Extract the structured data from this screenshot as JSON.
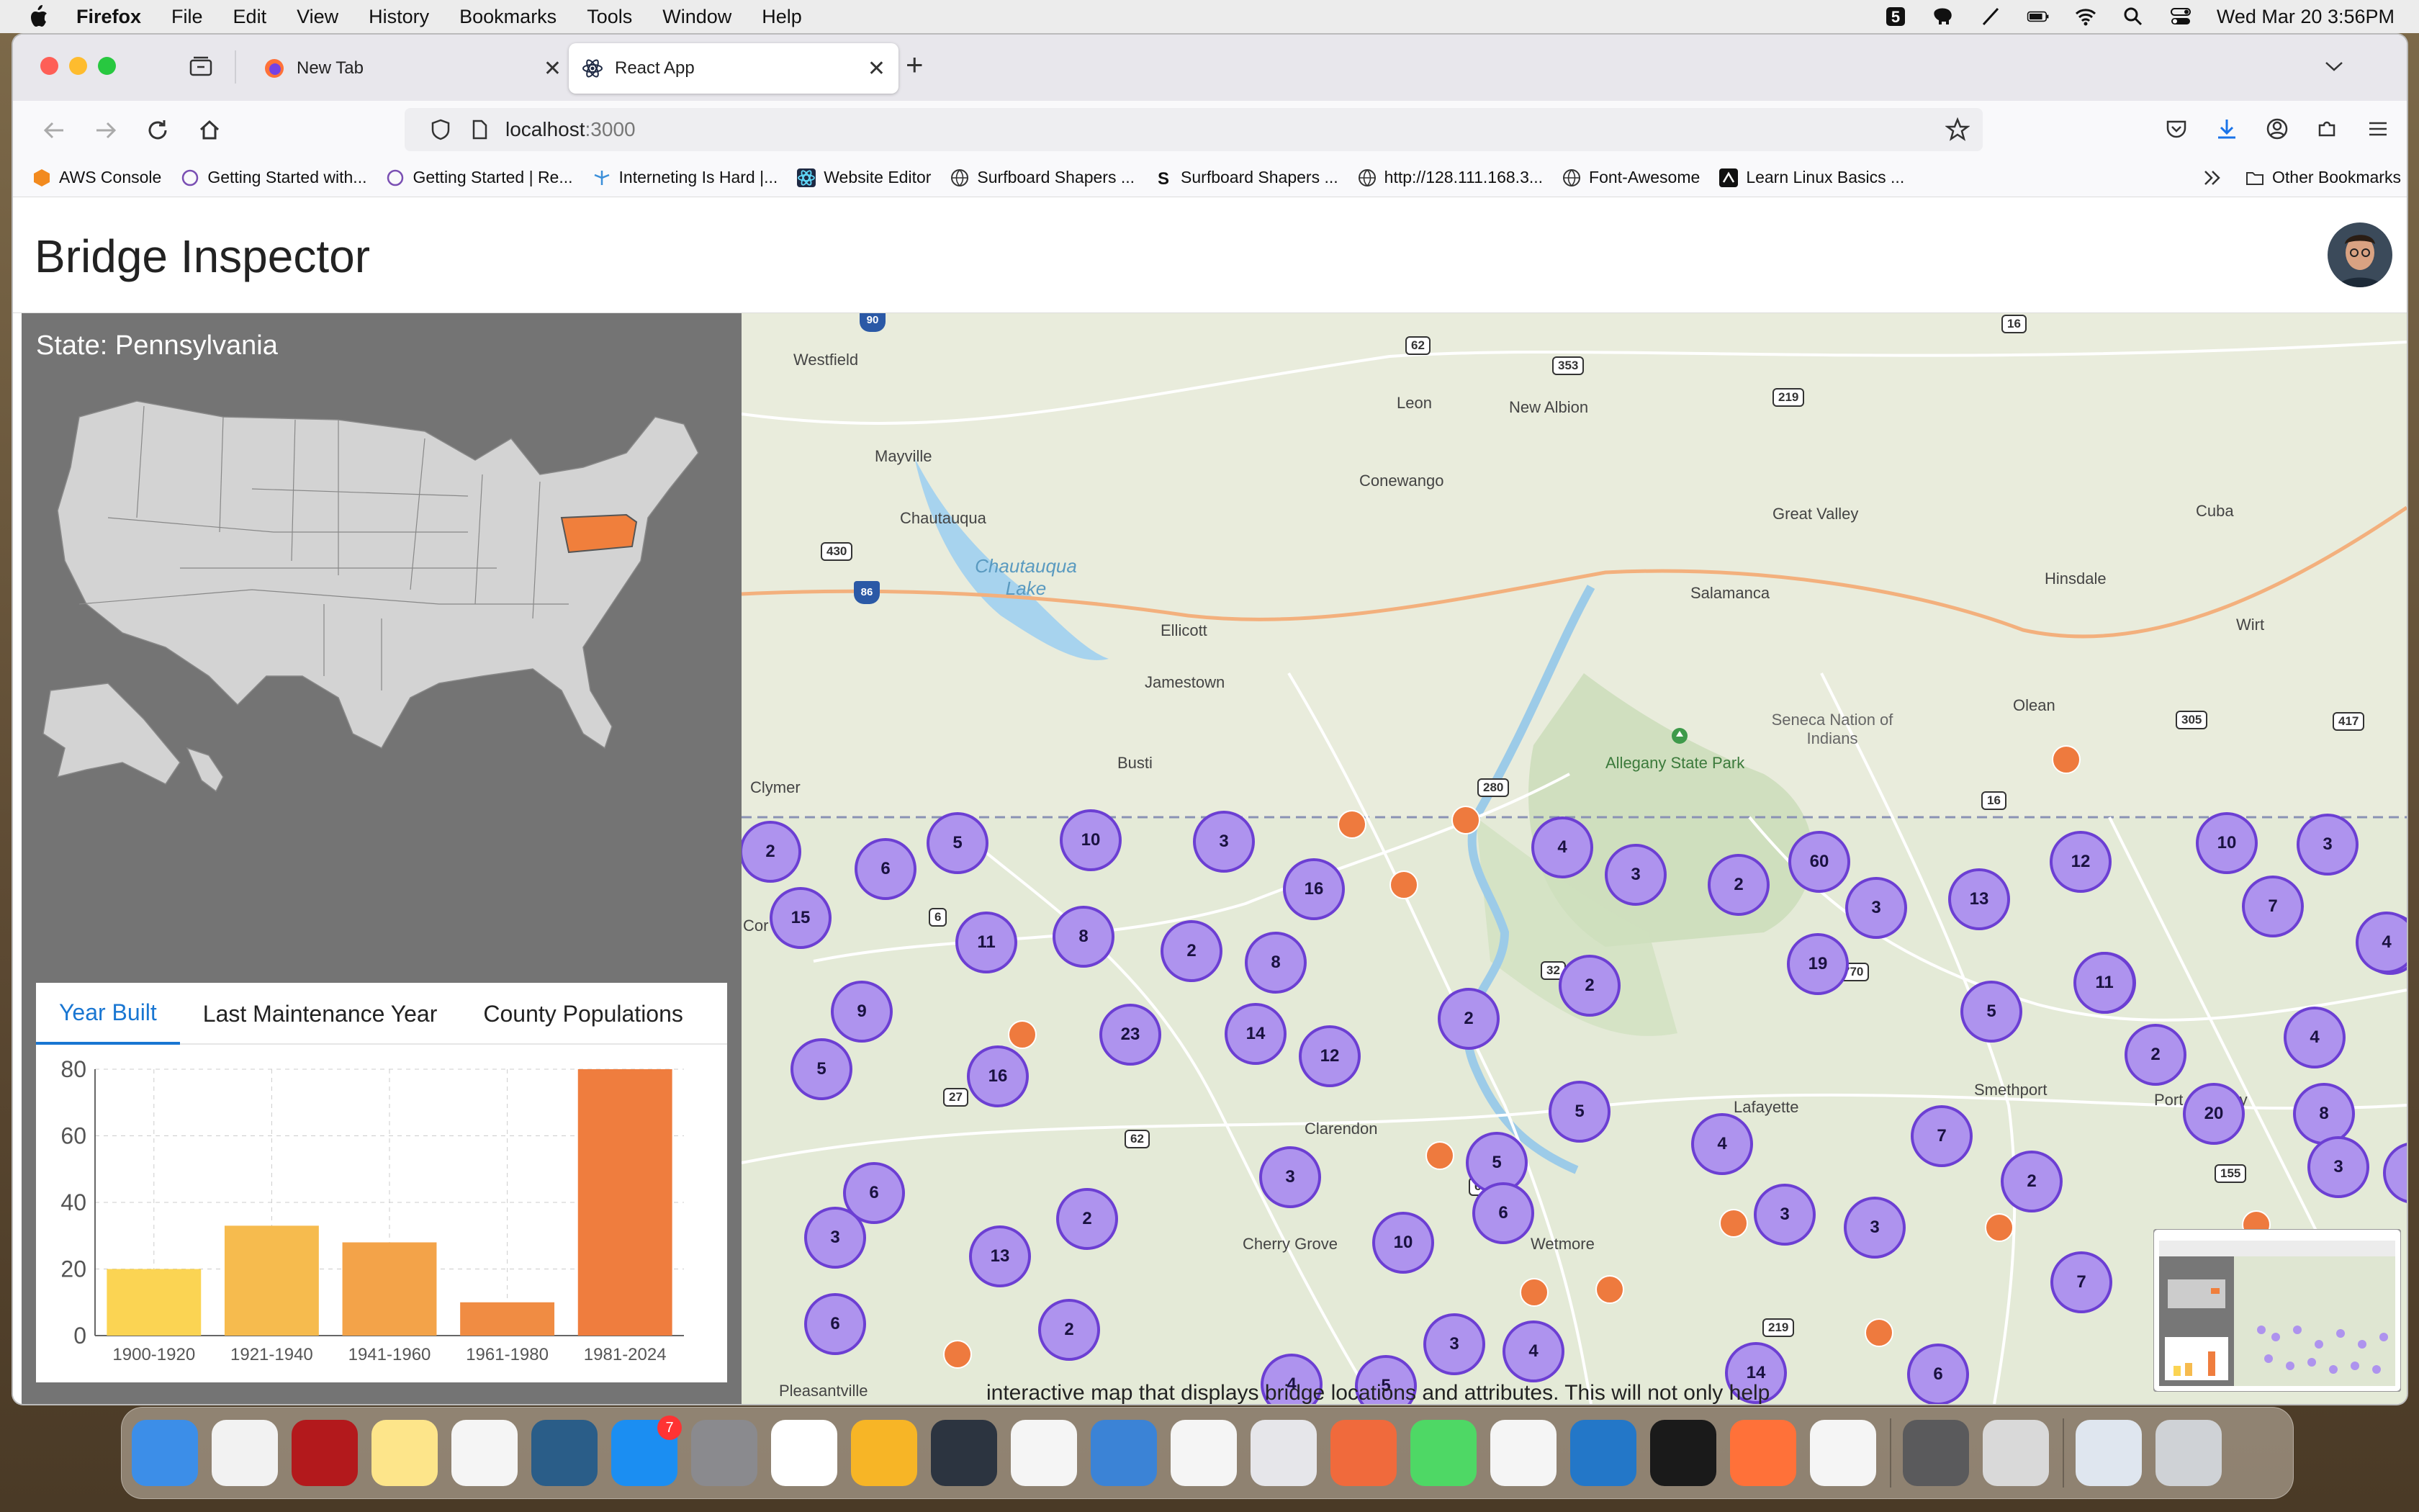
{
  "menubar": {
    "app": "Firefox",
    "items": [
      "File",
      "Edit",
      "View",
      "History",
      "Bookmarks",
      "Tools",
      "Window",
      "Help"
    ],
    "datetime": "Wed Mar 20  3:56PM"
  },
  "browser": {
    "tabs": [
      {
        "label": "New Tab",
        "active": false
      },
      {
        "label": "React App",
        "active": true
      }
    ],
    "url_host": "localhost",
    "url_port": ":3000",
    "bookmarks": [
      "AWS Console",
      "Getting Started with...",
      "Getting Started | Re...",
      "Interneting Is Hard |...",
      "Website Editor",
      "Surfboard Shapers ...",
      "Surfboard Shapers ...",
      "http://128.111.168.3...",
      "Font-Awesome",
      "Learn Linux Basics ..."
    ],
    "other_bookmarks": "Other Bookmarks"
  },
  "app": {
    "title": "Bridge Inspector",
    "state_label": "State: Pennsylvania",
    "highlight_color": "#f07f3c",
    "chart_tabs": [
      "Year Built",
      "Last Maintenance Year",
      "County Populations"
    ],
    "active_tab": "Year Built"
  },
  "chart_data": {
    "type": "bar",
    "categories": [
      "1900-1920",
      "1921-1940",
      "1941-1960",
      "1961-1980",
      "1981-2024"
    ],
    "values": [
      20,
      33,
      28,
      10,
      80
    ],
    "colors": [
      "#fbd453",
      "#f6bb4e",
      "#f3a349",
      "#f08c43",
      "#ef7d3e"
    ],
    "ylim": [
      0,
      80
    ],
    "yticks": [
      0,
      20,
      40,
      60,
      80
    ],
    "grid": true,
    "title": "",
    "xlabel": "",
    "ylabel": ""
  },
  "map": {
    "places": [
      {
        "name": "Westfield"
      },
      {
        "name": "Mayville"
      },
      {
        "name": "Chautauqua"
      },
      {
        "name": "Chautauqua Lake"
      },
      {
        "name": "Ellicott"
      },
      {
        "name": "Jamestown"
      },
      {
        "name": "Busti"
      },
      {
        "name": "Clymer"
      },
      {
        "name": "Leon"
      },
      {
        "name": "New Albion"
      },
      {
        "name": "Conewango"
      },
      {
        "name": "Great Valley"
      },
      {
        "name": "Salamanca"
      },
      {
        "name": "Hinsdale"
      },
      {
        "name": "Cuba"
      },
      {
        "name": "Wirt"
      },
      {
        "name": "Olean"
      },
      {
        "name": "Seneca Nation of Indians"
      },
      {
        "name": "Allegany State Park"
      },
      {
        "name": "Clarendon"
      },
      {
        "name": "Cherry Grove"
      },
      {
        "name": "Wetmore"
      },
      {
        "name": "Lafayette"
      },
      {
        "name": "Smethport"
      },
      {
        "name": "Port Allegany"
      },
      {
        "name": "Pleasantville"
      },
      {
        "name": "Cor"
      }
    ],
    "routes": [
      "90",
      "62",
      "353",
      "219",
      "16",
      "430",
      "86",
      "280",
      "6",
      "27",
      "62",
      "32",
      "770",
      "305",
      "417",
      "155",
      "6",
      "219",
      "16"
    ],
    "clusters": [
      2,
      6,
      5,
      10,
      3,
      16,
      4,
      3,
      2,
      60,
      3,
      13,
      12,
      10,
      3,
      7,
      13,
      15,
      11,
      8,
      2,
      8,
      19,
      11,
      9,
      5,
      16,
      23,
      14,
      12,
      2,
      2,
      5,
      11,
      2,
      4,
      20,
      8,
      5,
      6,
      3,
      3,
      5,
      13,
      2,
      3,
      10,
      6,
      4,
      3,
      2,
      8,
      7,
      2,
      6,
      3,
      4,
      7,
      3,
      4,
      14,
      6,
      4,
      5
    ],
    "cluster_color": "#ae93ee",
    "pin_color": "#ee7a3e"
  },
  "behind_text": "interactive map that displays bridge locations and attributes. This will not only help",
  "dock": {
    "apps": [
      "Finder",
      "TextEdit",
      "Acrobat",
      "Notes",
      "Freeform",
      "MySQL Workbench",
      "App Store",
      "System Settings",
      "Slack",
      "Sketch",
      "Atom",
      "Numbers",
      "Keynote",
      "Safari",
      "Launchpad",
      "Paw",
      "Messages",
      "Preview",
      "VS Code",
      "Terminal",
      "Firefox",
      "Chrome",
      "Calculator",
      "Disk Utility",
      "Downloads",
      "Trash"
    ],
    "appstore_badge": "7"
  }
}
